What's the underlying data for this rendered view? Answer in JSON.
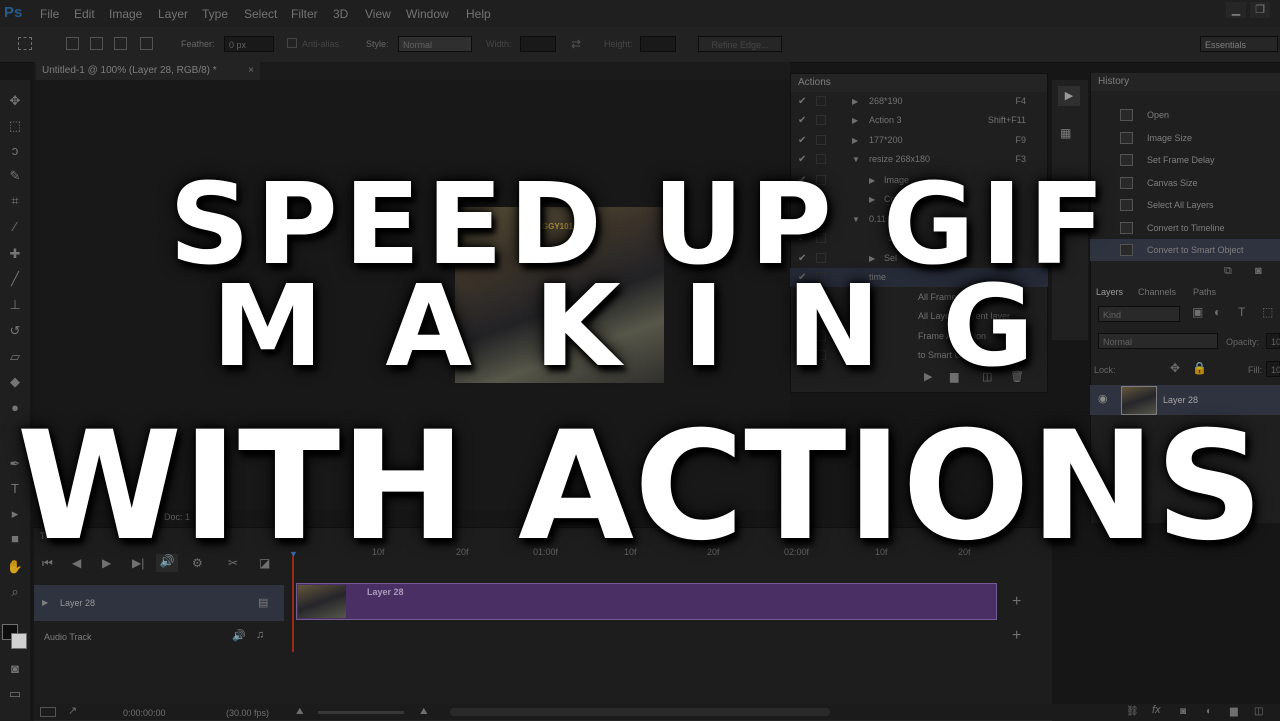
{
  "app": {
    "logo": "Ps"
  },
  "menu": [
    "File",
    "Edit",
    "Image",
    "Layer",
    "Type",
    "Select",
    "Filter",
    "3D",
    "View",
    "Window",
    "Help"
  ],
  "options": {
    "feather_label": "Feather:",
    "feather_value": "0 px",
    "antialias_label": "Anti-alias",
    "style_label": "Style:",
    "style_value": "Normal",
    "width_label": "Width:",
    "height_label": "Height:",
    "refine_label": "Refine Edge...",
    "workspace": "Essentials"
  },
  "document": {
    "tab_title": "Untitled-1 @ 100% (Layer 28, RGB/8) *",
    "doc_info": "Doc: 1"
  },
  "actions_panel": {
    "title": "Actions",
    "rows": [
      {
        "name": "268*190",
        "key": "F4",
        "expand": "▶"
      },
      {
        "name": "Action 3",
        "key": "Shift+F11",
        "expand": "▶"
      },
      {
        "name": "177*200",
        "key": "F9",
        "expand": "▶"
      },
      {
        "name": "resize 268x180",
        "key": "F3",
        "expand": "▼"
      },
      {
        "name": "Image",
        "key": "",
        "expand": "▶"
      },
      {
        "name": "Co",
        "key": "",
        "expand": "▶"
      },
      {
        "name": "0.11 f",
        "key": "",
        "expand": "▼"
      },
      {
        "name": "S",
        "key": "",
        "expand": ""
      },
      {
        "name": "Sel",
        "key": "",
        "expand": "▶"
      },
      {
        "name": "time",
        "key": "",
        "expand": ""
      },
      {
        "name": "All Frames",
        "key": "",
        "expand": ""
      },
      {
        "name": "All Layers current layer",
        "key": "",
        "expand": ""
      },
      {
        "name": "Frame Animation",
        "key": "",
        "expand": ""
      },
      {
        "name": "to Smart Object",
        "key": "",
        "expand": ""
      }
    ]
  },
  "photo": {
    "tag": "FROGGY101"
  },
  "history_panel": {
    "title": "History",
    "items": [
      "Open",
      "Image Size",
      "Set Frame Delay",
      "Canvas Size",
      "Select All Layers",
      "Convert to Timeline",
      "Convert to Smart Object"
    ]
  },
  "layers_panel": {
    "tabs": [
      "Layers",
      "Channels",
      "Paths"
    ],
    "kind_label": "Kind",
    "blend_mode": "Normal",
    "opacity_label": "Opacity:",
    "opacity_value": "10",
    "lock_label": "Lock:",
    "fill_label": "Fill:",
    "fill_value": "10",
    "layer_name": "Layer 28"
  },
  "timeline": {
    "title": "Timeline",
    "ticks": [
      "10f",
      "20f",
      "01:00f",
      "10f",
      "20f",
      "02:00f",
      "10f",
      "20f"
    ],
    "track_layer": "Layer 28",
    "track_audio": "Audio Track",
    "clip_label": "Layer 28",
    "timecode": "0:00:00:00",
    "fps": "(30.00 fps)"
  },
  "overlay": {
    "line1": "SPEED UP GIF",
    "line2": "MAKING",
    "line3": "WITH ACTIONS"
  }
}
